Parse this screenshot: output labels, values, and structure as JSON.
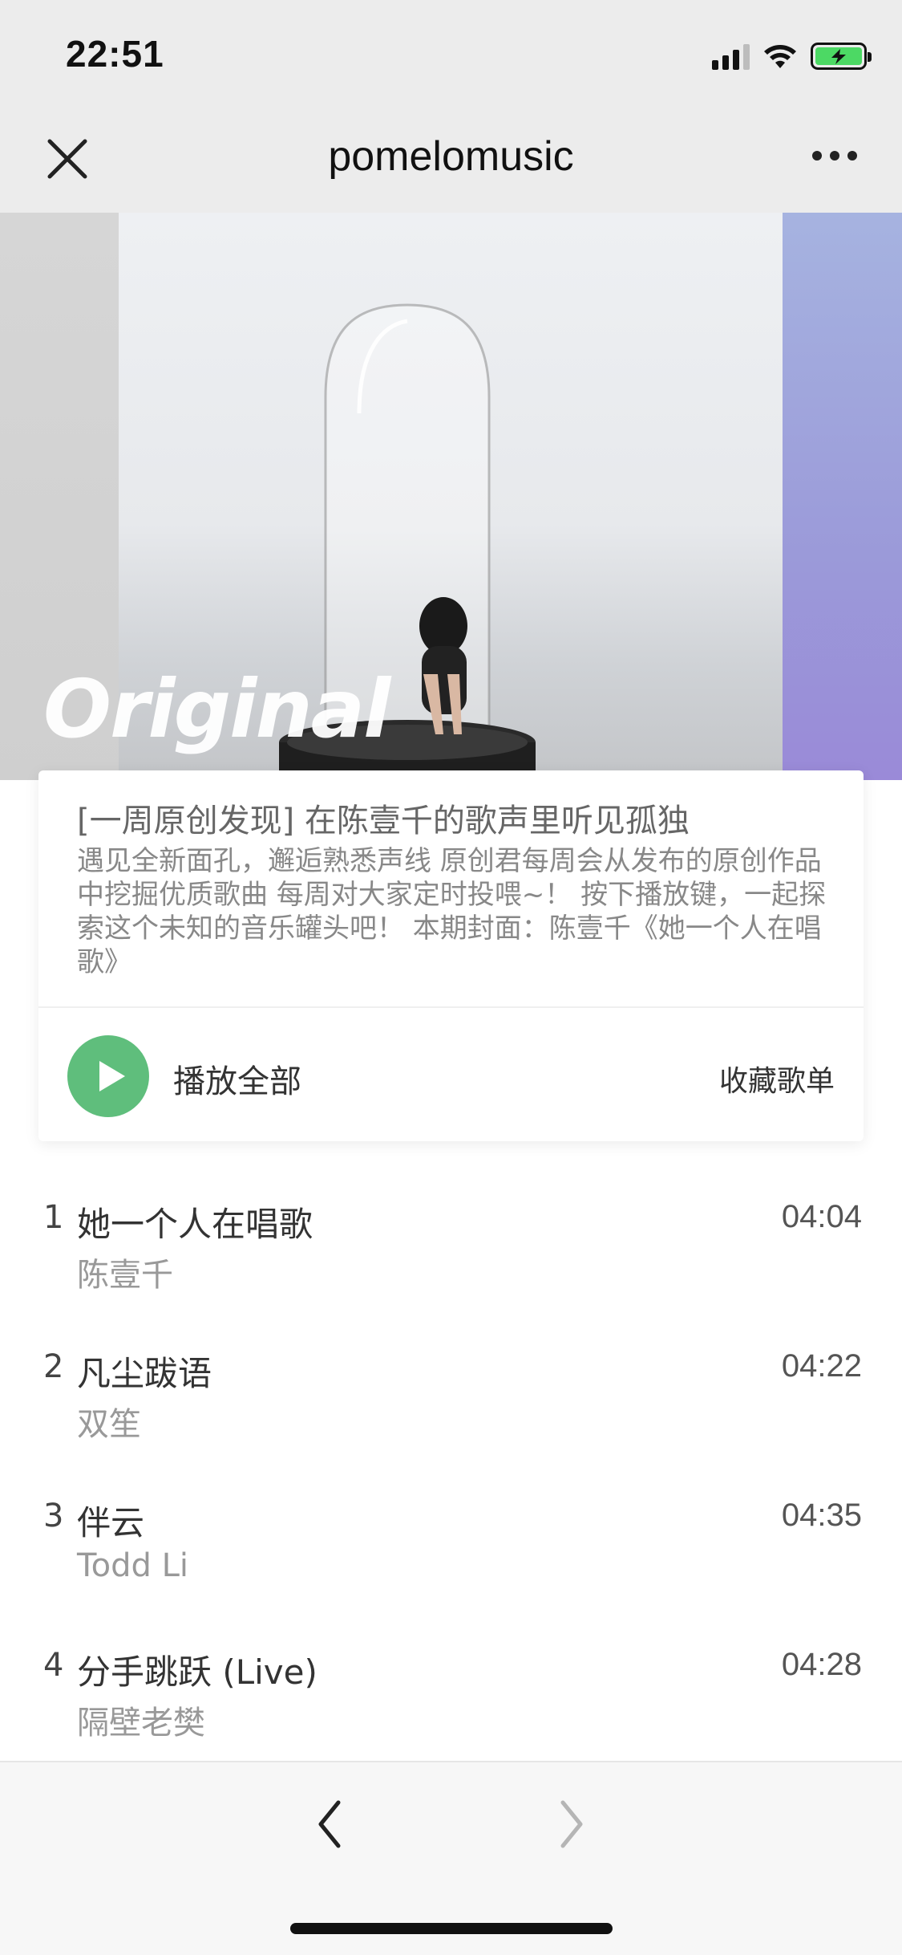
{
  "status": {
    "time": "22:51",
    "icons": [
      "signal-icon",
      "wifi-icon",
      "battery-charging-icon"
    ]
  },
  "nav": {
    "title": "pomelomusic",
    "close_icon": "close-icon",
    "more_icon": "more-icon"
  },
  "cover": {
    "overlay_text": "Original"
  },
  "playlist": {
    "title": "[一周原创发现] 在陈壹千的歌声里听见孤独",
    "description": "遇见全新面孔，邂逅熟悉声线 原创君每周会从发布的原创作品中挖掘优质歌曲 每周对大家定时投喂~！ 按下播放键，一起探索这个未知的音乐罐头吧！ 本期封面：陈壹千《她一个人在唱歌》",
    "play_all_label": "播放全部",
    "collect_label": "收藏歌单",
    "accent_color": "#5fbe7c"
  },
  "tracks": [
    {
      "num": "1",
      "title": "她一个人在唱歌",
      "artist": "陈壹千",
      "duration": "04:04"
    },
    {
      "num": "2",
      "title": "凡尘跋语",
      "artist": "双笙",
      "duration": "04:22"
    },
    {
      "num": "3",
      "title": "伴云",
      "artist": "Todd Li",
      "duration": "04:35"
    },
    {
      "num": "4",
      "title": "分手跳跃 (Live)",
      "artist": "隔壁老樊",
      "duration": "04:28"
    }
  ],
  "bottom_nav": {
    "back_icon": "chevron-left-icon",
    "forward_icon": "chevron-right-icon"
  }
}
